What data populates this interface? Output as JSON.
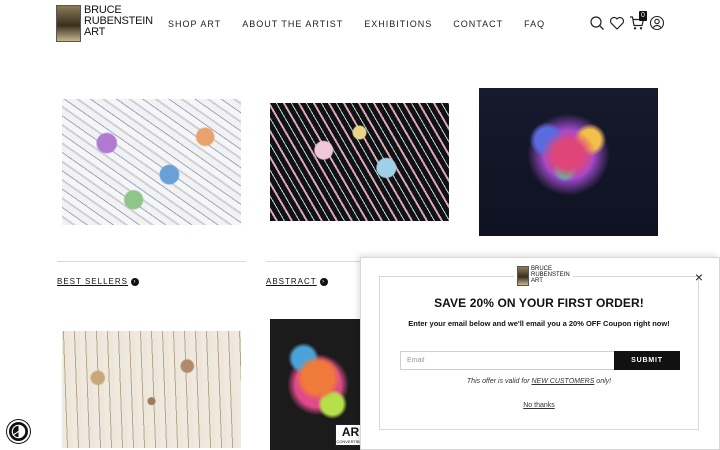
{
  "brand": {
    "line1": "BRUCE",
    "line2": "RUBENSTEIN",
    "line3": "ART"
  },
  "nav": {
    "items": [
      "SHOP ART",
      "ABOUT THE ARTIST",
      "EXHIBITIONS",
      "CONTACT",
      "FAQ"
    ]
  },
  "header_icons": {
    "search": "search-icon",
    "wishlist": "heart-icon",
    "cart": "cart-icon",
    "cart_count": "0",
    "account": "user-icon"
  },
  "categories": {
    "best_sellers": "BEST SELLERS",
    "abstract": "ABSTRACT"
  },
  "badge": {
    "main": "AR",
    "sub": "CONVERTIBLE"
  },
  "popup": {
    "title": "SAVE 20% ON YOUR FIRST ORDER!",
    "subtitle": "Enter your email below and we'll email you a 20% OFF Coupon right now!",
    "email_placeholder": "Email",
    "submit_label": "SUBMIT",
    "disclaimer_pre": "This offer is valid for ",
    "disclaimer_link": "NEW CUSTOMERS",
    "disclaimer_post": " only!",
    "no_thanks": "No thanks",
    "close": "×"
  },
  "colors": {
    "accent": "#111111",
    "background": "#ffffff"
  }
}
